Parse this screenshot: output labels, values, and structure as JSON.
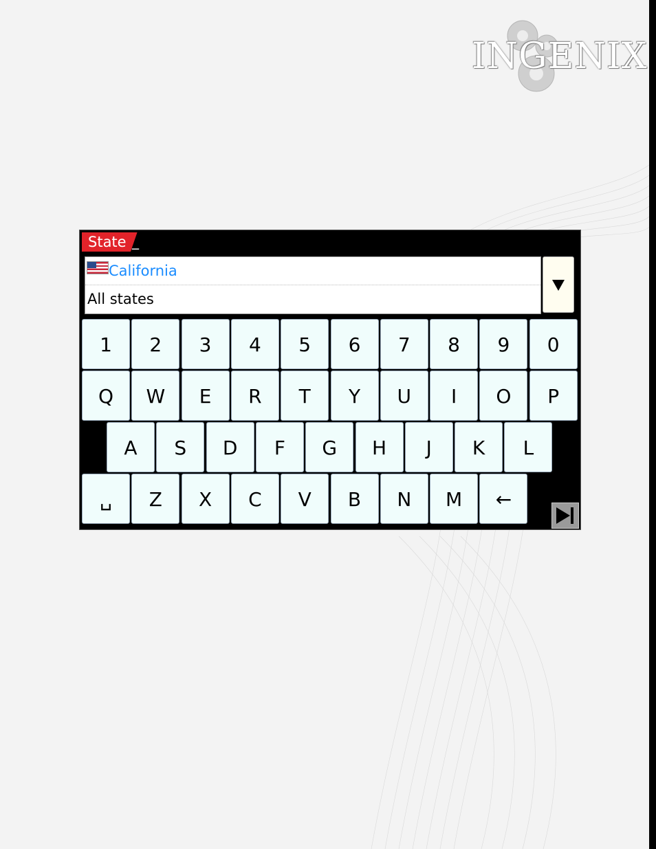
{
  "brand": {
    "logo_text": "INGENIX"
  },
  "field": {
    "label": "State",
    "input_value": "_"
  },
  "results": {
    "selected": "California",
    "other": "All states",
    "selected_flag_icon": "us-flag-icon"
  },
  "dropdown": {
    "icon": "triangle-down-icon"
  },
  "keyboard": {
    "row1": [
      "1",
      "2",
      "3",
      "4",
      "5",
      "6",
      "7",
      "8",
      "9",
      "0"
    ],
    "row2": [
      "Q",
      "W",
      "E",
      "R",
      "T",
      "Y",
      "U",
      "I",
      "O",
      "P"
    ],
    "row3": [
      "A",
      "S",
      "D",
      "F",
      "G",
      "H",
      "J",
      "K",
      "L"
    ],
    "row4": [
      "␣",
      "Z",
      "X",
      "C",
      "V",
      "B",
      "N",
      "M",
      "←"
    ]
  },
  "next_button": {
    "icon": "skip-next-icon"
  },
  "colors": {
    "tab_red": "#e2232a",
    "selected_blue": "#1a8cff",
    "key_face": "#f0fdfc"
  }
}
